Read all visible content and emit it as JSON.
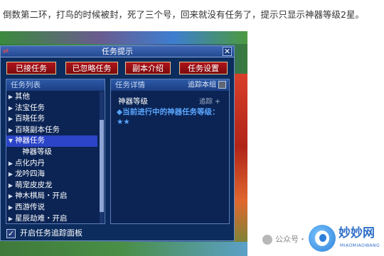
{
  "caption": "倒数第二环，打鸟的时候被封，死了三个号，回来就没有任务了，提示只显示神器等级2星。",
  "window": {
    "title": "任务提示",
    "close_label": "✕",
    "sys_icon": "⇌"
  },
  "buttons": {
    "accepted": "已接任务",
    "ignored": "已忽略任务",
    "dungeon": "副本介绍",
    "settings": "任务设置"
  },
  "list_panel": {
    "header": "任务列表",
    "items": [
      {
        "label": "其他",
        "arrow": "▶"
      },
      {
        "label": "法宝任务",
        "arrow": "▶"
      },
      {
        "label": "百晓任务",
        "arrow": "▶"
      },
      {
        "label": "百晓副本任务",
        "arrow": "▶"
      },
      {
        "label": "神器任务",
        "arrow": "▼"
      },
      {
        "label": "神器等级",
        "arrow": ""
      },
      {
        "label": "点化内丹",
        "arrow": "▶"
      },
      {
        "label": "龙吟四海",
        "arrow": "▶"
      },
      {
        "label": "萌宠皮皮龙",
        "arrow": "▶"
      },
      {
        "label": "神木棋局・开启",
        "arrow": "▶"
      },
      {
        "label": "西游传说",
        "arrow": "▶"
      },
      {
        "label": "星辰劫难・开启",
        "arrow": "▶"
      }
    ]
  },
  "detail_panel": {
    "header": "任务详情",
    "track_this": "追踪本组",
    "task_name": "神器等级",
    "track_label": "追踪 +",
    "task_text": "◆当前进行中的神器任务等级：★★"
  },
  "footer": {
    "checkbox_mark": "✓",
    "label": "开启任务追踪面板"
  },
  "watermark": {
    "wechat": "公众号・",
    "brand": "妙妙网",
    "brand_sub": "MIAOMIAOWANG"
  }
}
